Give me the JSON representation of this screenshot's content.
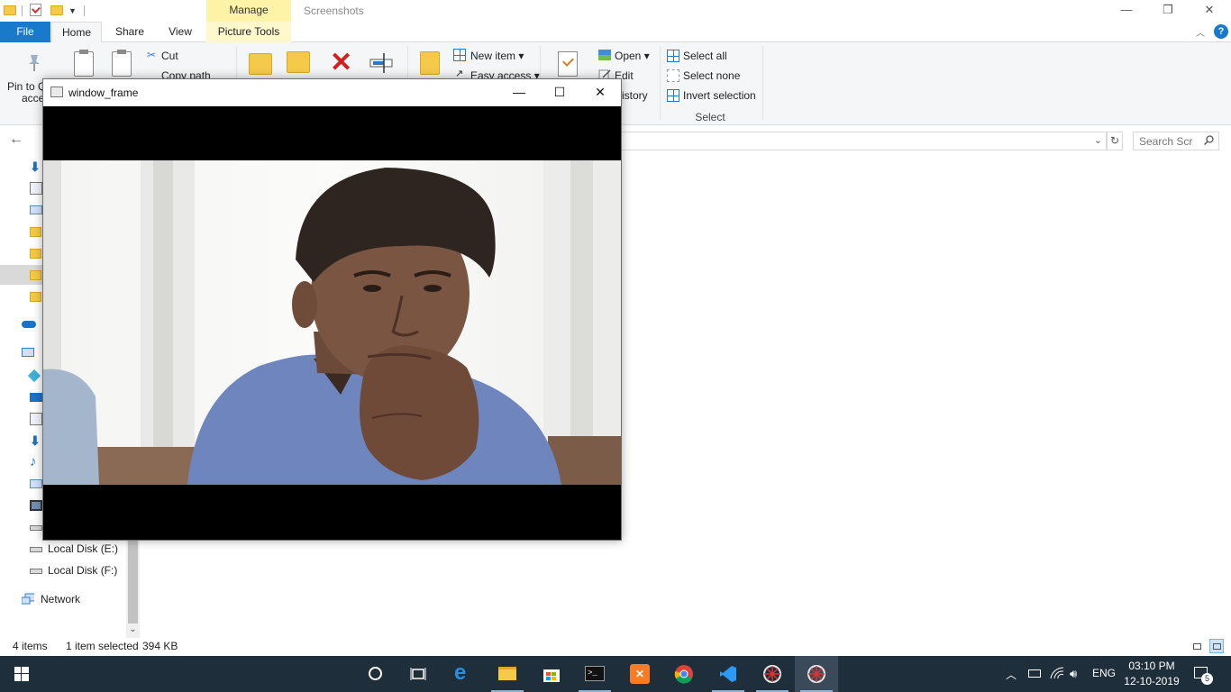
{
  "explorer": {
    "title": "Screenshots",
    "context_tab": "Manage",
    "window_controls": {
      "minimize": "—",
      "maximize": "❐",
      "close": "✕"
    }
  },
  "ribbon_tabs": [
    "File",
    "Home",
    "Share",
    "View",
    "Picture Tools"
  ],
  "ribbon": {
    "clipboard": {
      "pin_label_1": "Pin to Q",
      "pin_label_2": "acce",
      "cut": "Cut",
      "copy_path": "Copy path"
    },
    "new": {
      "new_item": "New item ▾",
      "easy_access": "Easy access ▾"
    },
    "open": {
      "open": "Open ▾",
      "edit": "Edit",
      "history": "istory"
    },
    "select": {
      "select_all": "Select all",
      "select_none": "Select none",
      "invert_selection": "Invert selection",
      "group_label": "Select"
    }
  },
  "navbar": {
    "back": "←",
    "search_placeholder": "Search Scr...",
    "refresh": "↻",
    "dropdown": "⌄"
  },
  "navpane": {
    "items": [
      {
        "label": "Local Disk (E:)",
        "icon": "drive-icon"
      },
      {
        "label": "Local Disk (F:)",
        "icon": "drive-icon"
      },
      {
        "label": "Network",
        "icon": "network-icon"
      }
    ]
  },
  "statusbar": {
    "item_count": "4 items",
    "selection": "1 item selected",
    "size": "394 KB"
  },
  "video_window": {
    "title": "window_frame",
    "minimize": "—",
    "maximize": "☐",
    "close": "✕"
  },
  "taskbar": {
    "apps": [
      "start-icon",
      "cortana-icon",
      "task-view-icon",
      "edge-icon",
      "file-explorer-icon",
      "store-icon",
      "terminal-icon",
      "xampp-icon",
      "chrome-icon",
      "vscode-icon",
      "opencv-app-icon",
      "opencv-app-icon"
    ],
    "language": "ENG",
    "time": "03:10 PM",
    "date": "12-10-2019",
    "notification_count": "5"
  },
  "colors": {
    "accent": "#1979ca",
    "taskbar": "#1f2e3b",
    "manage_tab": "#fff3a8"
  }
}
